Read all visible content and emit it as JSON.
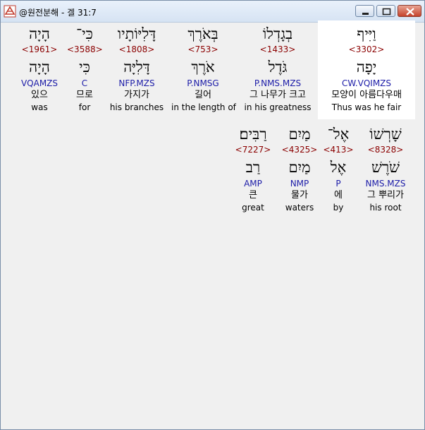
{
  "window": {
    "title": "@원전분해 - 겔 31:7",
    "icon": "bible-app-icon",
    "buttons": [
      "minimize",
      "maximize",
      "close"
    ]
  },
  "line1": [
    {
      "hebrew": "וַיִּיף",
      "strong": "<3302>",
      "lemma": "יָפָה",
      "parse": "CW.VQIMZS",
      "korean": "모양이 아름다우매",
      "english": "Thus was he fair"
    },
    {
      "hebrew": "בְגָדְלוֹ",
      "strong": "<1433>",
      "lemma": "גֹּדֶל",
      "parse": "P.NMS.MZS",
      "korean": "그 나무가 크고",
      "english": "in his greatness"
    },
    {
      "hebrew": "בְּאֹרֶךְ",
      "strong": "<753>",
      "lemma": "אֹרֶךְ",
      "parse": "P.NMSG",
      "korean": "길어",
      "english": "in the length of"
    },
    {
      "hebrew": "דָּלִיּוֹתָיו",
      "strong": "<1808>",
      "lemma": "דָּלִיָּה",
      "parse": "NFP.MZS",
      "korean": "가지가",
      "english": "his branches"
    },
    {
      "hebrew": "כִּי־",
      "strong": "<3588>",
      "lemma": "כִּי",
      "parse": "C",
      "korean": "므로",
      "english": "for"
    },
    {
      "hebrew": "הָיָה",
      "strong": "<1961>",
      "lemma": "הָיָה",
      "parse": "VQAMZS",
      "korean": "있으",
      "english": "was"
    }
  ],
  "line2": [
    {
      "hebrew": "שָׁרְשׁוֹ",
      "strong": "<8328>",
      "lemma": "שֹׁרֶשׁ",
      "parse": "NMS.MZS",
      "korean": "그 뿌리가",
      "english": "his root"
    },
    {
      "hebrew": "אֶל־",
      "strong": "<413>",
      "lemma": "אֶל",
      "parse": "P",
      "korean": "에",
      "english": "by"
    },
    {
      "hebrew": "מַיִם",
      "strong": "<4325>",
      "lemma": "מַיִם",
      "parse": "NMP",
      "korean": "물가",
      "english": "waters"
    },
    {
      "hebrew": "רַבִּים׃",
      "strong": "<7227>",
      "lemma": "רַב",
      "parse": "AMP",
      "korean": "큰",
      "english": "great"
    }
  ]
}
